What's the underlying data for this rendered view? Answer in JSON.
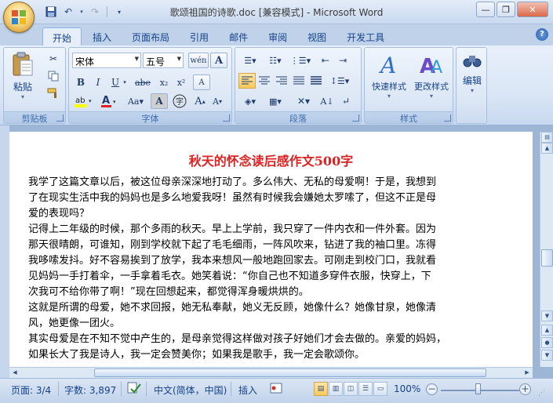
{
  "window": {
    "title": "歌颂祖国的诗歌.doc [兼容模式] - Microsoft Word"
  },
  "tabs": [
    {
      "label": "开始",
      "active": true
    },
    {
      "label": "插入"
    },
    {
      "label": "页面布局"
    },
    {
      "label": "引用"
    },
    {
      "label": "邮件"
    },
    {
      "label": "审阅"
    },
    {
      "label": "视图"
    },
    {
      "label": "开发工具"
    }
  ],
  "ribbon": {
    "clipboard": {
      "paste_label": "粘贴",
      "group_label": "剪贴板"
    },
    "font": {
      "font_name": "宋体",
      "font_size": "五号",
      "wen_label": "wén",
      "group_label": "字体"
    },
    "paragraph": {
      "group_label": "段落"
    },
    "styles": {
      "quick_styles_label": "快速样式",
      "change_styles_label": "更改样式",
      "group_label": "样式"
    },
    "editing": {
      "edit_label": "编辑"
    }
  },
  "document": {
    "title": "秋天的怀念读后感作文500字",
    "lines": [
      "我学了这篇文章以后，被这位母亲深深地打动了。多么伟大、无私的母爱啊！于是，我想到",
      "了在现实生活中我的妈妈也是多么地爱我呀！虽然有时候我会嫌她太罗嗦了，但这不正是母",
      "爱的表现吗？",
      "记得上二年级的时候，那个多雨的秋天。早上上学前，我只穿了一件内衣和一件外套。因为",
      "那天很晴朗，可谁知，刚到学校就下起了毛毛细雨，一阵风吹来，钻进了我的袖口里。冻得",
      "我哆嗦发抖。好不容易挨到了放学，我本来想风一般地跑回家去。可刚走到校门口，我就看",
      "见妈妈一手打着伞，一手拿着毛衣。她笑着说：“你自己也不知道多穿件衣服，快穿上，下",
      "次我可不给你带了啊！”现在回想起来，都觉得浑身暖烘烘的。",
      "这就是所谓的母爱，她不求回报，她无私奉献，她义无反顾，她像什么？她像甘泉，她像清",
      "风，她更像一团火。",
      "其实母爱是在不知不觉中产生的，是母亲觉得这样做对孩子好她们才会去做的。亲爱的妈妈，",
      "如果长大了我是诗人，我一定会赞美你；如果我是歌手，我一定会歌颂你。"
    ]
  },
  "statusbar": {
    "page": "页面: 3/4",
    "words": "字数: 3,897",
    "language": "中文(简体，中国)",
    "mode": "插入",
    "zoom": "100%",
    "zoom_level": 100
  }
}
